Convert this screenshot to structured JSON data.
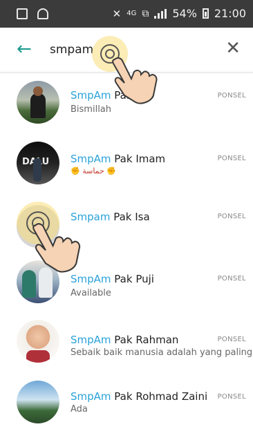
{
  "status": {
    "network_label": "4G",
    "battery_text": "54%",
    "time": "21:00"
  },
  "search": {
    "query": "smpam"
  },
  "contacts": [
    {
      "highlight": "SmpAm",
      "name": " Pak Eko",
      "subtitle": "Bismillah",
      "tag": "PONSEL"
    },
    {
      "highlight": "SmpAm",
      "name": " Pak Imam",
      "subtitle": "✊ حماسة ✊",
      "tag": "PONSEL"
    },
    {
      "highlight": "Smpam",
      "name": " Pak Isa",
      "subtitle": "",
      "tag": "PONSEL"
    },
    {
      "highlight": "SmpAm",
      "name": " Pak Puji",
      "subtitle": "Available",
      "tag": "PONSEL"
    },
    {
      "highlight": "SmpAm",
      "name": " Pak Rahman",
      "subtitle": "Sebaik baik manusia adalah yang paling...",
      "tag": "PONSEL"
    },
    {
      "highlight": "SmpAm",
      "name": " Pak Rohmad Zaini",
      "subtitle": "Ada",
      "tag": "PONSEL"
    }
  ],
  "colors": {
    "accent": "#1c9a8f",
    "highlight": "#2aa2d9",
    "statusbar": "#3b3b3b"
  }
}
